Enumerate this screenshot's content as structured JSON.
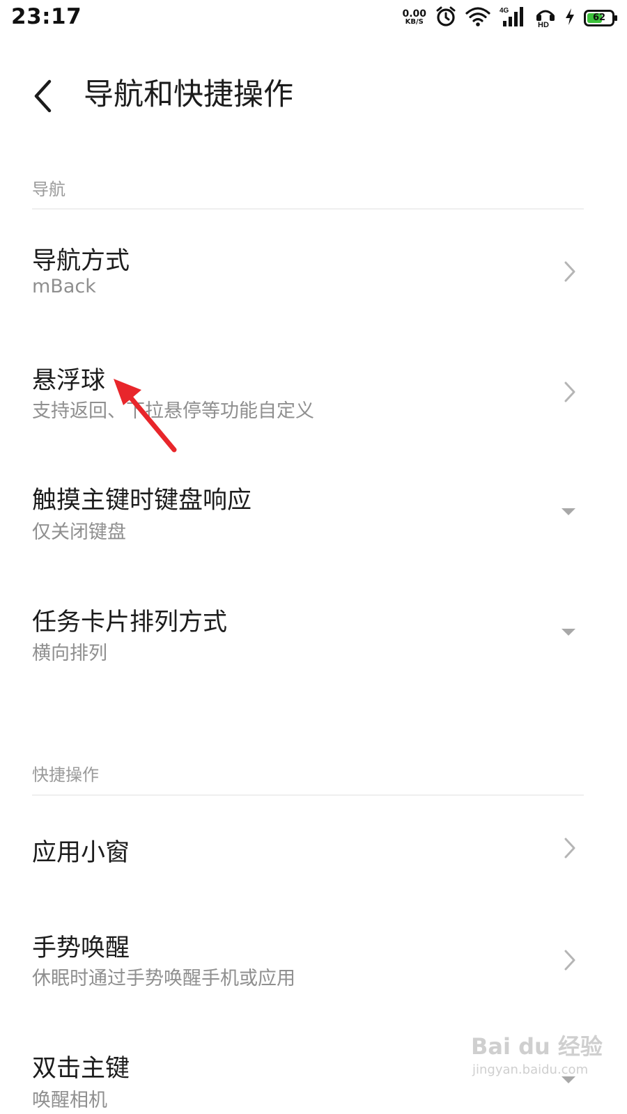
{
  "status_bar": {
    "time": "23:17",
    "net_speed_value": "0.00",
    "net_speed_unit": "KB/S",
    "network_type": "4G",
    "hd_label": "HD",
    "battery_level": "62",
    "battery_fraction": 0.62,
    "battery_color": "#3cc13b",
    "icons": [
      "alarm-clock-icon",
      "wifi-icon",
      "signal-icon",
      "hd-icon",
      "charging-bolt-icon",
      "battery-icon"
    ]
  },
  "header": {
    "back_icon": "back-chevron-icon",
    "title": "导航和快捷操作"
  },
  "sections": [
    {
      "label": "导航",
      "items": [
        {
          "title": "导航方式",
          "subtitle": "mBack",
          "control": "chevron-right-icon"
        },
        {
          "title": "悬浮球",
          "subtitle": "支持返回、下拉悬停等功能自定义",
          "control": "chevron-right-icon"
        },
        {
          "title": "触摸主键时键盘响应",
          "subtitle": "仅关闭键盘",
          "control": "dropdown-caret-icon"
        },
        {
          "title": "任务卡片排列方式",
          "subtitle": "横向排列",
          "control": "dropdown-caret-icon"
        }
      ]
    },
    {
      "label": "快捷操作",
      "items": [
        {
          "title": "应用小窗",
          "subtitle": "",
          "control": "chevron-right-icon"
        },
        {
          "title": "手势唤醒",
          "subtitle": "休眠时通过手势唤醒手机或应用",
          "control": "chevron-right-icon"
        },
        {
          "title": "双击主键",
          "subtitle": "唤醒相机",
          "control": "dropdown-caret-icon"
        }
      ]
    }
  ],
  "annotation": {
    "icon": "red-arrow-icon",
    "color": "#e8262b"
  },
  "watermark": {
    "main": "Bai du 经验",
    "sub": "jingyan.baidu.com"
  }
}
